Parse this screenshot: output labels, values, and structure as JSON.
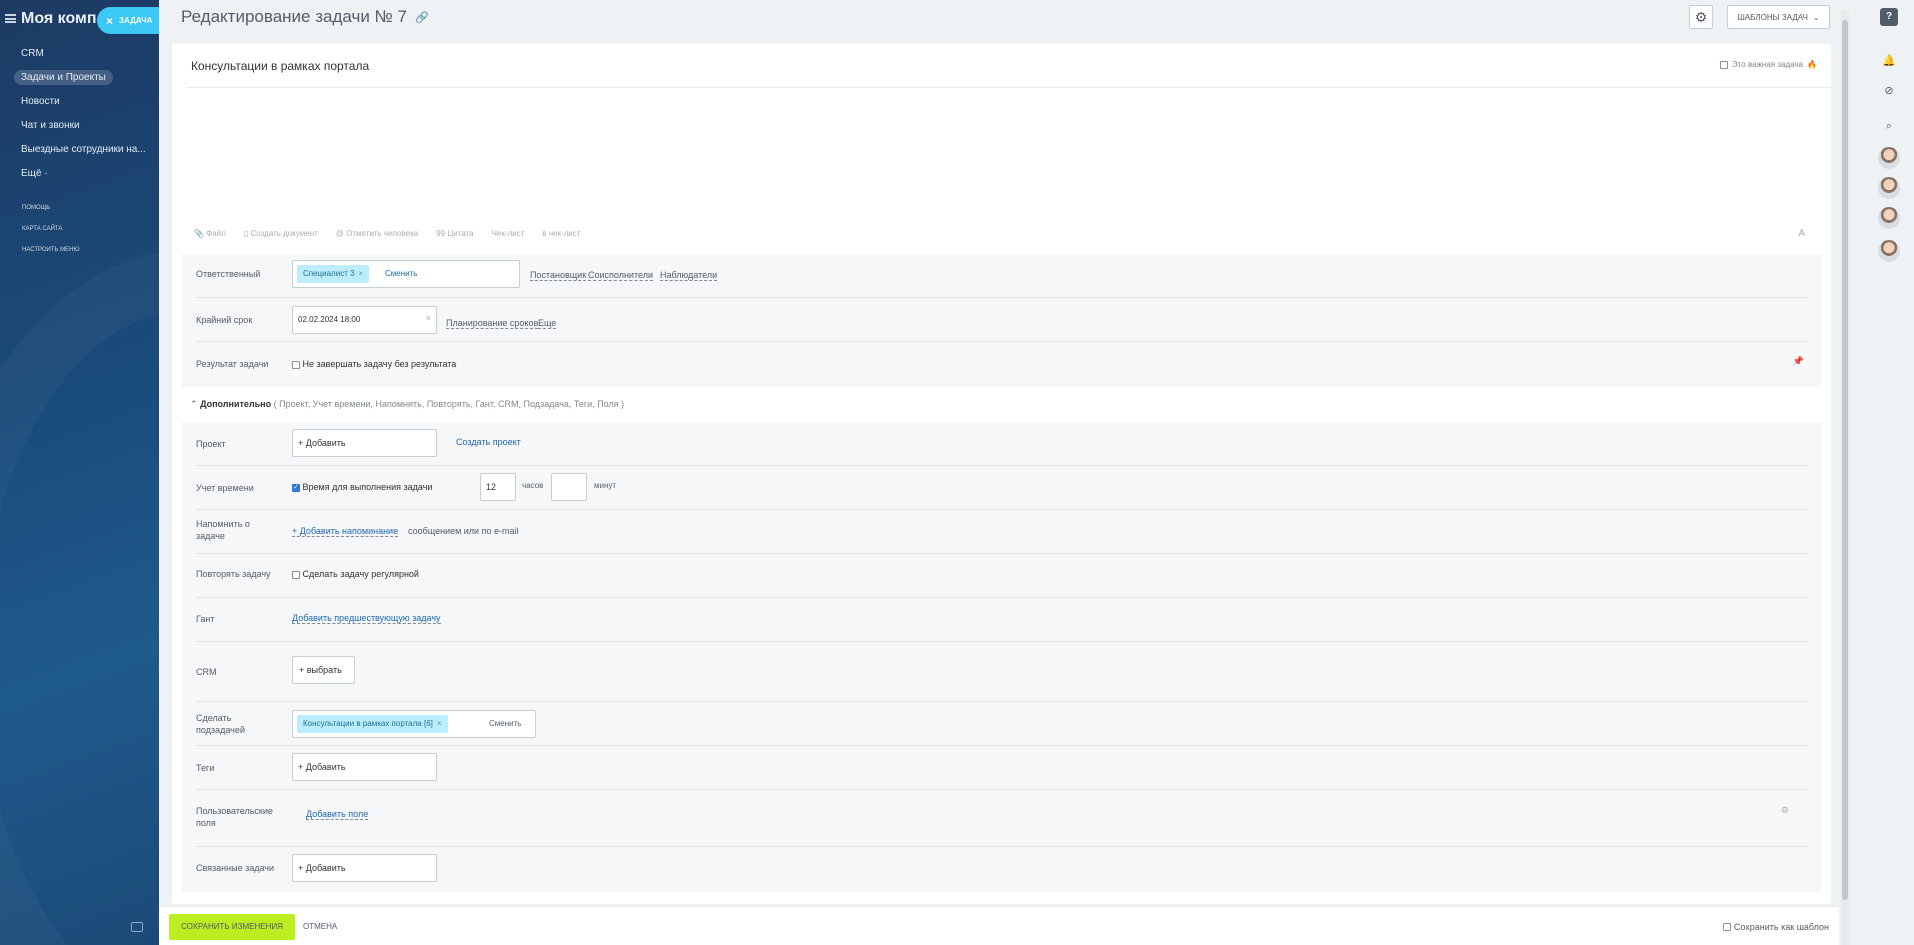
{
  "sidebar": {
    "title": "Моя комп",
    "task_button": "ЗАДАЧА",
    "items": [
      {
        "label": "CRM"
      },
      {
        "label": "Задачи и Проекты"
      },
      {
        "label": "Новости"
      },
      {
        "label": "Чат и звонки"
      },
      {
        "label": "Выездные сотрудники на..."
      },
      {
        "label": "Ещё ·"
      }
    ],
    "small_links": [
      "ПОМОЩЬ",
      "КАРТА САЙТА",
      "НАСТРОИТЬ МЕНЮ"
    ]
  },
  "header": {
    "title": "Редактирование задачи № 7",
    "templates_button": "ШАБЛОНЫ ЗАДАЧ"
  },
  "task": {
    "title": "Консультации в рамках портала",
    "important_label": "Это важная задача"
  },
  "toolbar": {
    "file": "Файл",
    "create_doc": "Создать документ",
    "mention": "Отметить человека",
    "quote": "Цитата",
    "checklist": "Чек-лист",
    "to_checklist": "в чек-лист",
    "format": "A"
  },
  "main_fields": {
    "responsible_label": "Ответственный",
    "responsible_value": "Специалист 3",
    "change": "Сменить",
    "creator": "Постановщик",
    "accomplices": "Соисполнители",
    "observers": "Наблюдатели",
    "deadline_label": "Крайний срок",
    "deadline_value": "02.02.2024 18:00",
    "planning": "Планирование сроков",
    "more": "Еще",
    "result_label": "Результат задачи",
    "result_checkbox": "Не завершать задачу без результата"
  },
  "extra": {
    "title": "Дополнительно",
    "summary": "( Проект,  Учет времени,  Напомнить,  Повторять,  Гант,  CRM,  Подзадача,  Теги,  Поля )",
    "project_label": "Проект",
    "add": "+ Добавить",
    "create_project": "Создать проект",
    "time_label": "Учет времени",
    "time_checkbox": "Время для выполнения задачи",
    "hours_value": "12",
    "hours_unit": "часов",
    "minutes_unit": "минут",
    "remind_label": "Напомнить о задаче",
    "remind_link": "+ Добавить напоминание",
    "remind_text": "сообщением или по e-mail",
    "repeat_label": "Повторять задачу",
    "repeat_checkbox": "Сделать задачу регулярной",
    "gantt_label": "Гант",
    "gantt_link": "Добавить предшествующую задачу",
    "crm_label": "CRM",
    "crm_button": "+  выбрать",
    "subtask_label": "Сделать подзадачей",
    "subtask_value": "Консультации в рамках портала [6]",
    "subtask_change": "Сменить",
    "tags_label": "Теги",
    "userfields_label": "Пользовательские поля",
    "userfields_link": "Добавить поле",
    "related_label": "Связанные задачи"
  },
  "footer": {
    "save": "СОХРАНИТЬ ИЗМЕНЕНИЯ",
    "cancel": "ОТМЕНА",
    "save_template": "Сохранить как шаблон"
  }
}
